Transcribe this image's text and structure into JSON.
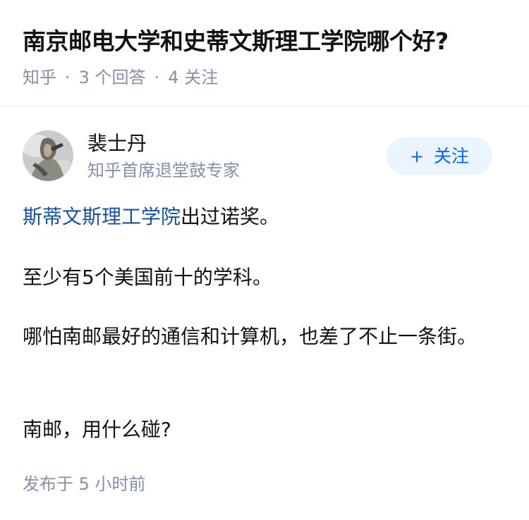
{
  "question": {
    "title": "南京邮电大学和史蒂文斯理工学院哪个好?",
    "source": "知乎",
    "separator": "·",
    "answer_count": "3 个回答",
    "follower_count": "4 关注"
  },
  "author": {
    "name": "裴士丹",
    "headline": "知乎首席退堂鼓专家",
    "follow_plus": "+",
    "follow_label": "关注"
  },
  "answer": {
    "p1_link": "斯蒂文斯理工学院",
    "p1_text": "出过诺奖。",
    "p2": "至少有5个美国前十的学科。",
    "p3": "哪怕南邮最好的通信和计算机，也差了不止一条街。",
    "p4": "南邮，用什么碰?"
  },
  "footer": {
    "published": "发布于 5 小时前"
  },
  "colors": {
    "link": "#175199",
    "brand_blue": "#0066ff",
    "follow_bg": "#ebf5ff",
    "meta_gray": "#8590a6"
  }
}
